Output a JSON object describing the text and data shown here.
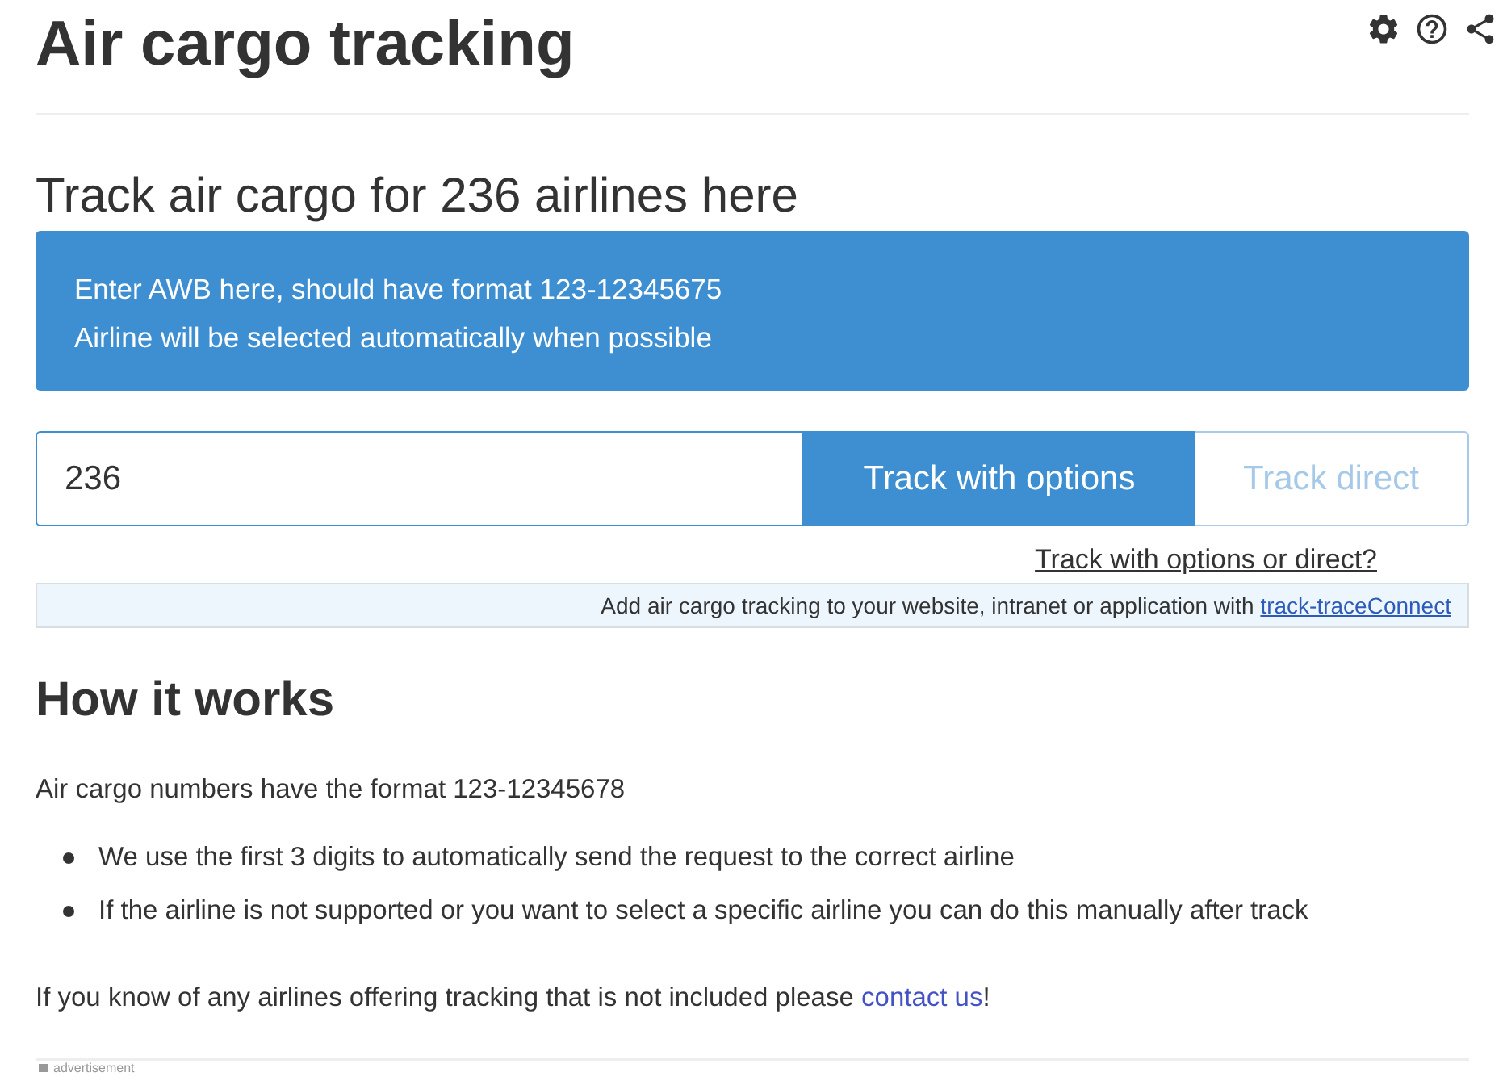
{
  "title": "Air cargo tracking",
  "subtitle": "Track air cargo for 236 airlines here",
  "notice": {
    "lines": [
      "Enter AWB here, should have format 123-12345675",
      "Airline will be selected automatically when possible"
    ]
  },
  "tracking_form": {
    "value": "236",
    "buttons": [
      {
        "label": "Track with options",
        "kind": "primary",
        "disabled": false
      },
      {
        "label": "Track direct",
        "kind": "secondary",
        "disabled": true
      }
    ],
    "help_link": "Track with options or direct?"
  },
  "connect_banner": {
    "text": "Add air cargo tracking to your website, intranet or application with",
    "link": "track-traceConnect"
  },
  "how_it_works": {
    "heading": "How it works",
    "intro": "Air cargo numbers have the format 123-12345678",
    "bullets": [
      "We use the first 3 digits to automatically send the request to the correct airline",
      "If the airline is not supported or you want to select a specific airline you can do this manually after track"
    ],
    "contact": {
      "text": "If you know of any airlines offering tracking that is not included please",
      "link": "contact us",
      "suffix": "!"
    }
  },
  "footer": {
    "label": "advertisement"
  }
}
